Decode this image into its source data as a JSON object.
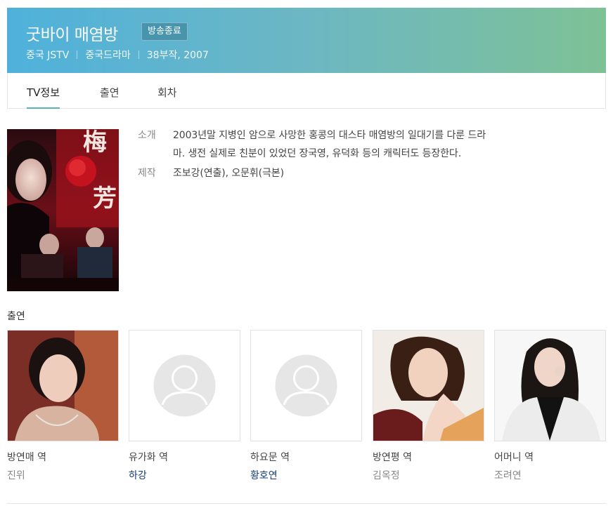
{
  "header": {
    "title": "굿바이 매염방",
    "status_badge": "방송종료",
    "channel": "중국 JSTV",
    "genre": "중국드라마",
    "episodes_year": "38부작, 2007"
  },
  "tabs": [
    {
      "label": "TV정보"
    },
    {
      "label": "출연"
    },
    {
      "label": "회차"
    }
  ],
  "info": {
    "intro_label": "소개",
    "intro_line1": "2003년말 지병인 암으로 사망한 홍콩의 대스타 매염방의 일대기를 다룬 드라",
    "intro_line2": "마. 생전 실제로 친분이 있었던 장국영, 유덕화 등의 캐릭터도 등장한다.",
    "production_label": "제작",
    "production": "조보강(연출), 오문휘(극본)"
  },
  "cast_section_title": "출연",
  "cast": [
    {
      "role": "방연매 역",
      "actor": "진위"
    },
    {
      "role": "유가화 역",
      "actor": "하강"
    },
    {
      "role": "하요문 역",
      "actor": "황호연"
    },
    {
      "role": "방연평 역",
      "actor": "김옥정"
    },
    {
      "role": "어머니 역",
      "actor": "조려연"
    }
  ],
  "colors": {
    "header_gradient_start": "#4fb1db",
    "header_gradient_end": "#7ec196",
    "tab_underline": "#5ab4b8",
    "actor_link": "#123d7c"
  }
}
